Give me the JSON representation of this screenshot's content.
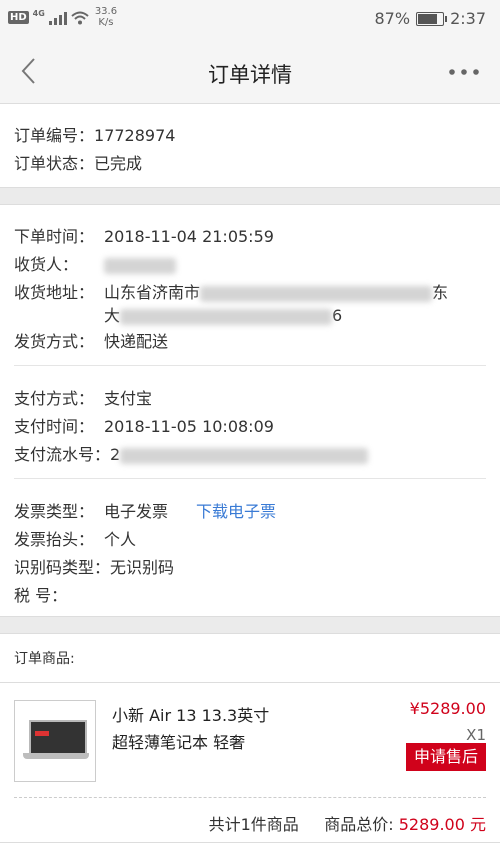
{
  "status_bar": {
    "hd": "HD",
    "network": "4G",
    "speed_value": "33.6",
    "speed_unit": "K/s",
    "battery_text": "87%",
    "battery_level": 0.87,
    "time": "2:37"
  },
  "header": {
    "title": "订单详情"
  },
  "order": {
    "number_label": "订单编号：",
    "number_value": "17728974",
    "status_label": "订单状态：",
    "status_value": "已完成"
  },
  "delivery": {
    "order_time_label": "下单时间：",
    "order_time_value": "2018-11-04 21:05:59",
    "receiver_label": "收货人：",
    "address_label": "收货地址：",
    "address_line1_visible": "山东省济南市",
    "address_line1_tail": "东",
    "address_line2_visible": "大",
    "address_line2_tail": "6",
    "shipping_label": "发货方式：",
    "shipping_value": "快递配送"
  },
  "payment": {
    "method_label": "支付方式：",
    "method_value": "支付宝",
    "time_label": "支付时间：",
    "time_value": "2018-11-05 10:08:09",
    "serial_label": "支付流水号：",
    "serial_prefix": "2"
  },
  "invoice": {
    "type_label": "发票类型：",
    "type_value": "电子发票",
    "download_link": "下载电子票",
    "title_label": "发票抬头：",
    "title_value": "个人",
    "id_type_label": "识别码类型：",
    "id_type_value": "无识别码",
    "tax_label": "税 号："
  },
  "products": {
    "section_label": "订单商品:",
    "items": [
      {
        "name_line1": "小新 Air 13 13.3英寸",
        "name_line2": "超轻薄笔记本 轻奢",
        "price": "¥5289.00",
        "qty": "X1",
        "after_sale_label": "申请售后"
      }
    ],
    "summary_count": "共计1件商品",
    "summary_total_label": "商品总价:",
    "summary_total_value": "5289.00 元"
  },
  "colors": {
    "accent_red": "#d0021b",
    "link_blue": "#3a7bd5"
  }
}
